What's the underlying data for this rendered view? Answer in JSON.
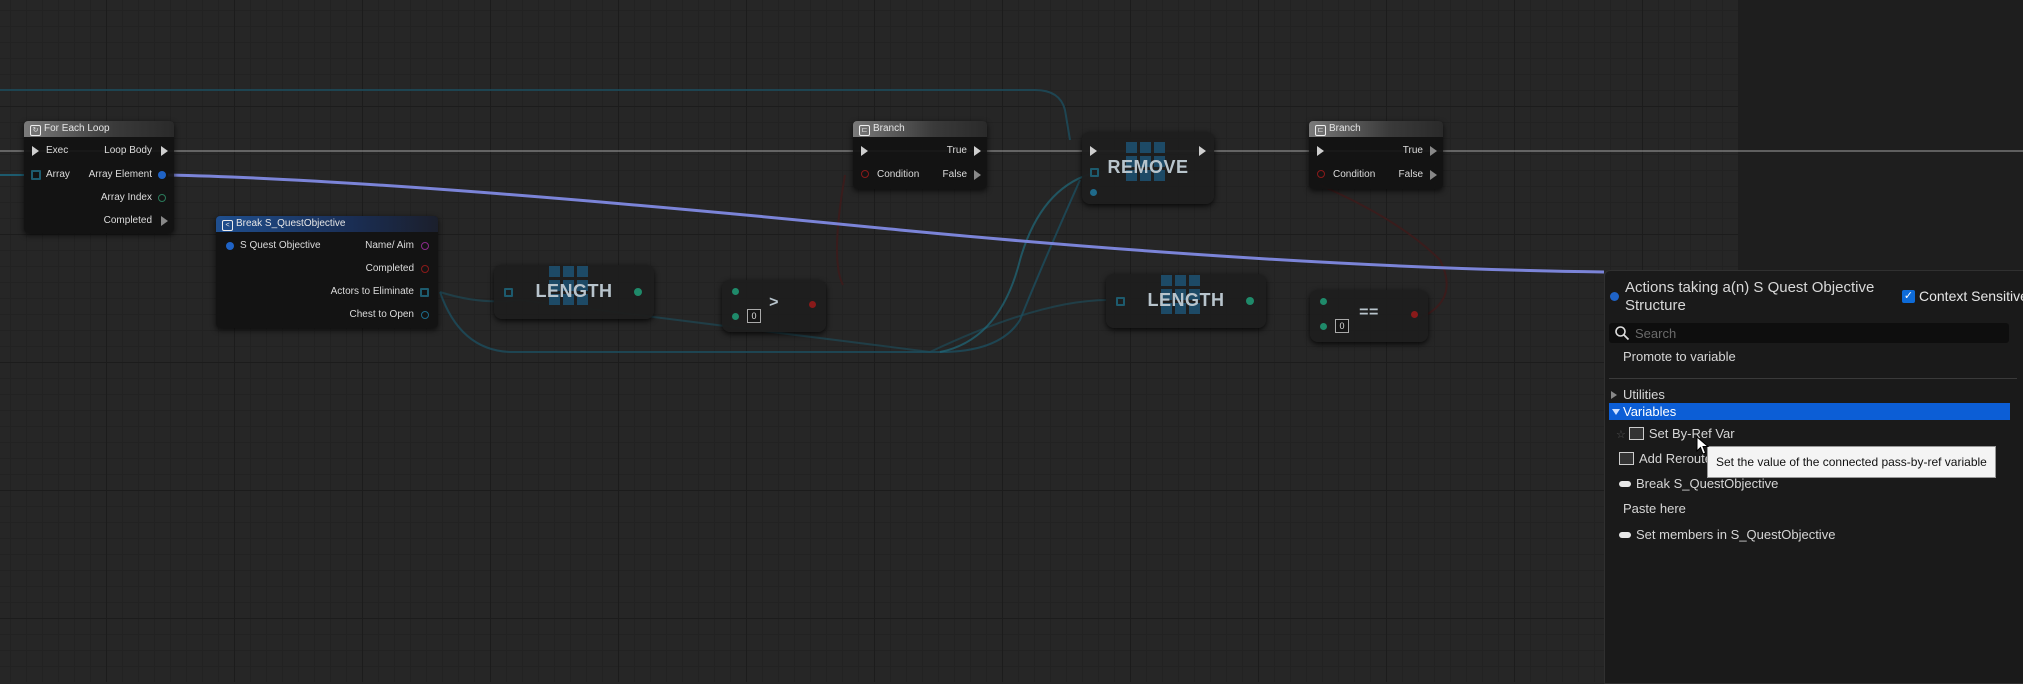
{
  "nodes": {
    "for_each": {
      "title": "For Each Loop",
      "pins": {
        "exec": "Exec",
        "array": "Array",
        "loop_body": "Loop Body",
        "array_element": "Array Element",
        "array_index": "Array Index",
        "completed": "Completed"
      }
    },
    "break_struct": {
      "title": "Break S_QuestObjective",
      "pins": {
        "input": "S Quest Objective",
        "name": "Name/ Aim",
        "completed": "Completed",
        "actors": "Actors to Eliminate",
        "chest": "Chest to Open"
      }
    },
    "length_1": {
      "label": "LENGTH"
    },
    "greater": {
      "op": ">",
      "zero": "0"
    },
    "branch_1": {
      "title": "Branch",
      "pins": {
        "condition": "Condition",
        "true": "True",
        "false": "False"
      }
    },
    "remove": {
      "label": "REMOVE"
    },
    "length_2": {
      "label": "LENGTH"
    },
    "equals": {
      "op": "==",
      "zero": "0"
    },
    "branch_2": {
      "title": "Branch",
      "pins": {
        "condition": "Condition",
        "true": "True",
        "false": "False"
      }
    }
  },
  "menu": {
    "title": "Actions taking a(n) S Quest Objective Structure",
    "context_sensitive_label": "Context Sensitive",
    "context_sensitive_checked": true,
    "search_placeholder": "Search",
    "search_value": "",
    "items": {
      "promote": "Promote to variable",
      "utilities": "Utilities",
      "variables": "Variables",
      "set_by_ref": "Set By-Ref Var",
      "add_reroute": "Add Reroute Node...",
      "break": "Break S_QuestObjective",
      "paste": "Paste here",
      "set_members": "Set members in S_QuestObjective"
    }
  },
  "tooltip": "Set the value of the connected pass-by-ref variable",
  "colors": {
    "struct_wire": "#7b84d8",
    "exec_wire": "#c9c9c9",
    "array_wire": "#1d5b6e",
    "bool_pin": "#8a1a1a",
    "selection": "#0c5ed6"
  }
}
